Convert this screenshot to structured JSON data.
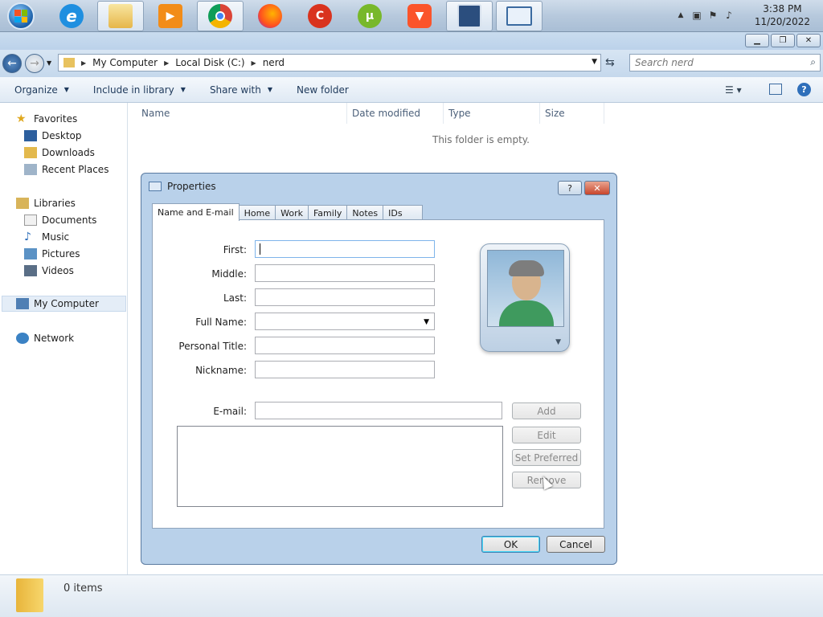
{
  "taskbar": {
    "clock_time": "3:38 PM",
    "clock_date": "11/20/2022",
    "pinned": [
      "internet-explorer",
      "file-explorer",
      "media-player",
      "chrome",
      "firefox",
      "ccleaner",
      "utorrent",
      "brave",
      "paint-app",
      "contacts-app"
    ]
  },
  "window": {
    "breadcrumbs": [
      "My Computer",
      "Local Disk (C:)",
      "nerd"
    ],
    "search_placeholder": "Search nerd",
    "commands": {
      "organize": "Organize",
      "include": "Include in library",
      "share": "Share with",
      "new_folder": "New folder"
    },
    "nav": {
      "favorites": "Favorites",
      "desktop": "Desktop",
      "downloads": "Downloads",
      "recent": "Recent Places",
      "libraries": "Libraries",
      "documents": "Documents",
      "music": "Music",
      "pictures": "Pictures",
      "videos": "Videos",
      "computer": "My Computer",
      "network": "Network"
    },
    "columns": [
      "Name",
      "Date modified",
      "Type",
      "Size"
    ],
    "empty_message": "This folder is empty.",
    "status_count": "0 items"
  },
  "dialog": {
    "title": "Properties",
    "help_label": "?",
    "tabs": [
      "Name and E-mail",
      "Home",
      "Work",
      "Family",
      "Notes",
      "IDs"
    ],
    "labels": {
      "first": "First:",
      "middle": "Middle:",
      "last": "Last:",
      "full_name": "Full Name:",
      "personal_title": "Personal Title:",
      "nickname": "Nickname:",
      "email": "E-mail:"
    },
    "buttons": {
      "add": "Add",
      "edit": "Edit",
      "set_preferred": "Set Preferred",
      "remove": "Remove",
      "ok": "OK",
      "cancel": "Cancel"
    }
  }
}
